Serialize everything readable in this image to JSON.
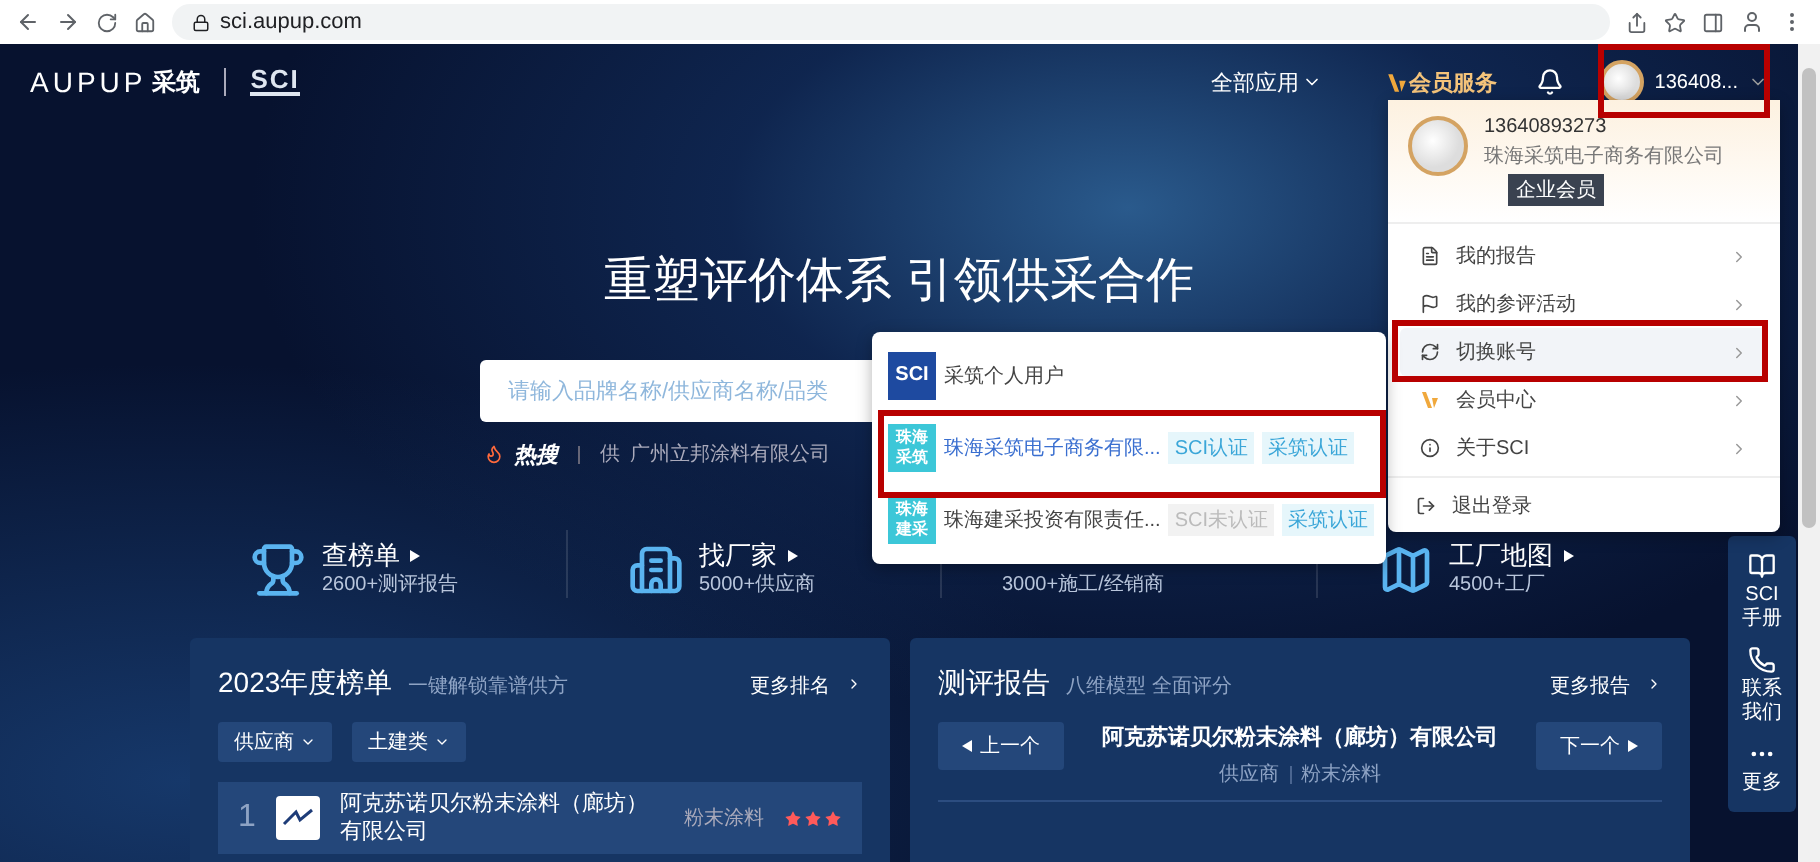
{
  "browser": {
    "url": "sci.aupup.com"
  },
  "header": {
    "logo": "AUPUP",
    "logo_cn": "采筑",
    "sci_logo": "SCI",
    "apps_menu": "全部应用",
    "vip_link": "会员服务",
    "user": "136408..."
  },
  "hero": {
    "title": "重塑评价体系 引领供采合作",
    "search": {
      "placeholder": "请输入品牌名称/供应商名称/品类"
    },
    "hot": {
      "label": "热搜",
      "tag": "供",
      "item": "广州立邦涂料有限公司"
    }
  },
  "stats": [
    {
      "kind": "trophy",
      "title": "查榜单",
      "caption": "2600+测评报告"
    },
    {
      "kind": "building",
      "title": "找厂家",
      "caption": "5000+供应商"
    },
    {
      "kind": "text_only",
      "caption": "3000+施工/经销商"
    },
    {
      "kind": "map",
      "title": "工厂地图",
      "caption": "4500+工厂"
    }
  ],
  "ranking_panel": {
    "title": "2023年度榜单",
    "subtitle": "一键解锁靠谱供方",
    "more": "更多排名",
    "filters": [
      "供应商",
      "土建类"
    ],
    "rows": [
      {
        "rank": "1",
        "name": "阿克苏诺贝尔粉末涂料（廊坊）有限公司",
        "category": "粉末涂料",
        "stars": 3
      }
    ]
  },
  "report_panel": {
    "title": "测评报告",
    "subtitle": "八维模型 全面评分",
    "more": "更多报告",
    "prev": "上一个",
    "next": "下一个",
    "company": "阿克苏诺贝尔粉末涂料（廊坊）有限公司",
    "meta": [
      "供应商",
      "粉末涂料"
    ]
  },
  "side_toolbar": [
    {
      "kind": "manual",
      "label": "SCI手册"
    },
    {
      "kind": "phone",
      "label": "联系我们"
    },
    {
      "kind": "more",
      "label": "更多"
    }
  ],
  "user_menu": {
    "phone": "13640893273",
    "company": "珠海采筑电子商务有限公司",
    "badge": "企业会员",
    "items": [
      {
        "kind": "report",
        "label": "我的报告",
        "selected": false
      },
      {
        "kind": "flag",
        "label": "我的参评活动",
        "selected": false
      },
      {
        "kind": "switch",
        "label": "切换账号",
        "selected": true
      },
      {
        "kind": "vip",
        "label": "会员中心",
        "selected": false
      },
      {
        "kind": "info",
        "label": "关于SCI",
        "selected": false
      }
    ],
    "logout": "退出登录"
  },
  "account_menu": [
    {
      "kind": "sci",
      "logo": "SCI",
      "name": "采筑个人用户",
      "selected": false
    },
    {
      "kind": "company",
      "logo": "珠海采筑",
      "name": "珠海采筑电子商务有限...",
      "selected": true,
      "badges": [
        {
          "label": "SCI认证",
          "certified": true
        },
        {
          "label": "采筑认证",
          "certified": true
        }
      ]
    },
    {
      "kind": "company",
      "logo": "珠海建采",
      "name": "珠海建采投资有限责任...",
      "selected": false,
      "badges": [
        {
          "label": "SCI未认证",
          "certified": false
        },
        {
          "label": "采筑认证",
          "certified": true
        }
      ]
    }
  ]
}
